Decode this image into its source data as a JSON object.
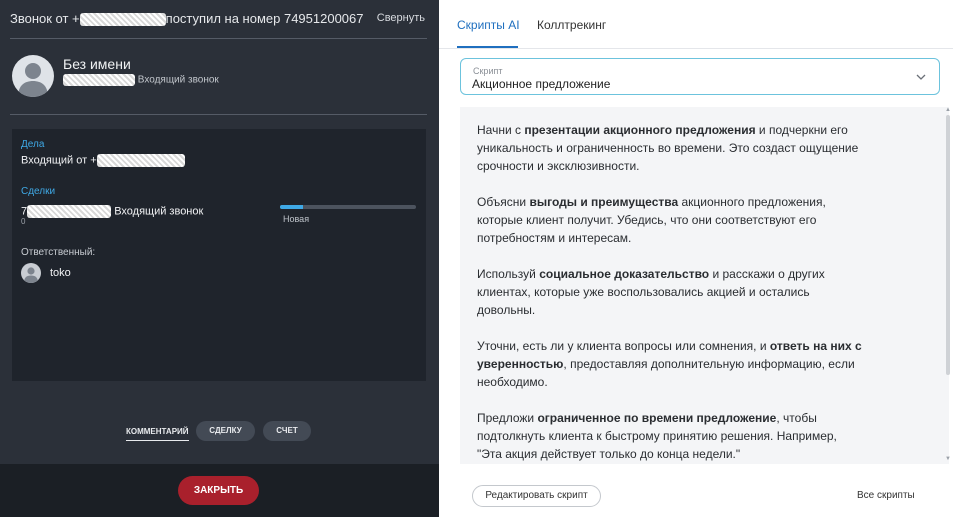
{
  "call": {
    "title_prefix": "Звонок от +",
    "title_suffix": "поступил на номер 74951200067",
    "collapse_label": "Свернуть"
  },
  "contact": {
    "name": "Без имени",
    "call_type": "Входящий звонок"
  },
  "info": {
    "tasks_label": "Дела",
    "task_text": "Входящий от +",
    "deals_label": "Сделки",
    "deal_prefix": "7",
    "deal_text": "Входящий звонок",
    "deal_num_prefix": "0",
    "deal_stage": "Новая",
    "deal_progress_percent": 17,
    "responsible_label": "Ответственный:",
    "responsible_name": "toko"
  },
  "bottom_tabs": {
    "comment": "КОММЕНТАРИЙ",
    "deal": "СДЕЛКУ",
    "invoice": "СЧЕТ"
  },
  "close_label": "ЗАКРЫТЬ",
  "right": {
    "tabs": [
      {
        "label": "Скрипты AI",
        "active": true
      },
      {
        "label": "Коллтрекинг",
        "active": false
      }
    ],
    "select": {
      "label": "Скрипт",
      "value": "Акционное предложение"
    },
    "script": {
      "p1": {
        "a": "Начни с ",
        "b": "презентации акционного предложения",
        "c": " и подчеркни его уникальность и ограниченность во времени. Это создаст ощущение срочности и эксклюзивности."
      },
      "p2": {
        "a": "Объясни ",
        "b": "выгоды и преимущества",
        "c": " акционного предложения, которые клиент получит. Убедись, что они соответствуют его потребностям и интересам."
      },
      "p3": {
        "a": "Используй ",
        "b": "социальное доказательство",
        "c": " и расскажи о других клиентах, которые уже воспользовались акцией и остались довольны."
      },
      "p4": {
        "a": "Уточни, есть ли у клиента вопросы или сомнения, и ",
        "b": "ответь на них с уверенностью",
        "c": ", предоставляя дополнительную информацию, если необходимо."
      },
      "p5": {
        "a": "Предложи ",
        "b": "ограниченное по времени предложение",
        "c": ", чтобы подтолкнуть клиента к быстрому принятию решения. Например, \"Эта акция действует только до конца недели.\""
      }
    },
    "edit_label": "Редактировать скрипт",
    "all_scripts_label": "Все скрипты"
  }
}
